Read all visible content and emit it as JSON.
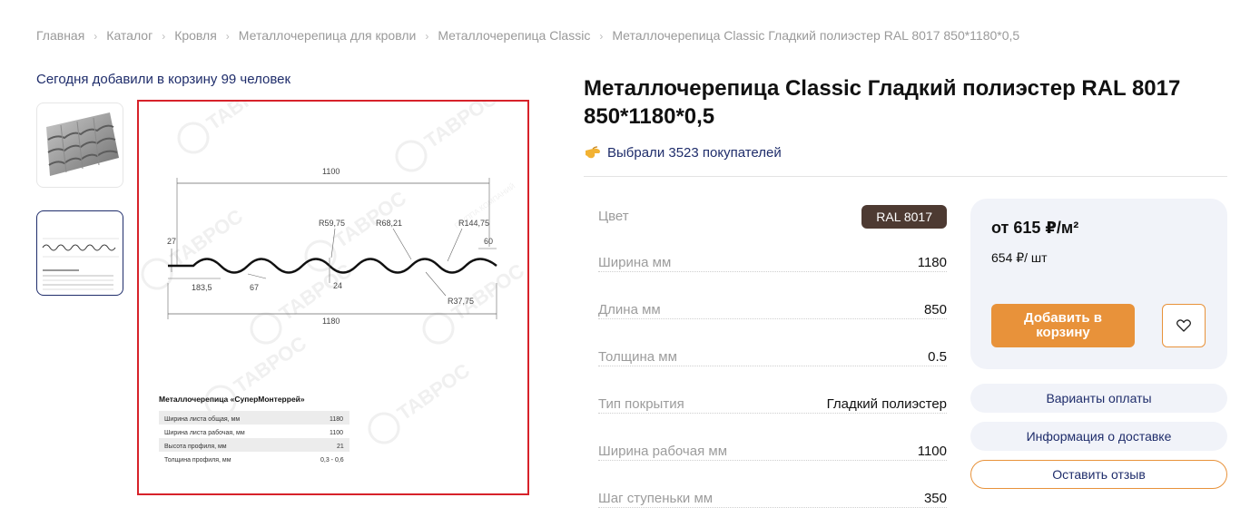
{
  "breadcrumb": {
    "items": [
      "Главная",
      "Каталог",
      "Кровля",
      "Металлочерепица для кровли",
      "Металлочерепица Classic",
      "Металлочерепица Classic Гладкий полиэстер RAL 8017 850*1180*0,5"
    ],
    "separator": "›"
  },
  "added_note": "Сегодня добавили в корзину 99 человек",
  "product": {
    "title": "Металлочерепица Classic Гладкий полиэстер RAL 8017 850*1180*0,5",
    "chosen_text": "Выбрали 3523 покупателей",
    "chosen_icon": "pointing-hand-icon"
  },
  "drawing": {
    "watermark": "ТАВРОС",
    "watermark_sub": "ГРУППА КОМПАНИЙ",
    "dims": {
      "top_width": "1100",
      "bottom_width": "1180",
      "left_height": "27",
      "right_end": "60",
      "r1": "R59,75",
      "r2": "R68,21",
      "r3": "R144,75",
      "r4": "R37,75",
      "pitch": "183,5",
      "wave": "67",
      "depth": "24"
    },
    "table_title": "Металлочерепица «СуперМонтеррей»",
    "table_rows": [
      {
        "label": "Ширина листа общая, мм",
        "value": "1180"
      },
      {
        "label": "Ширина листа рабочая, мм",
        "value": "1100"
      },
      {
        "label": "Высота профиля, мм",
        "value": "21"
      },
      {
        "label": "Толщина профиля, мм",
        "value": "0,3 - 0,6"
      }
    ]
  },
  "specs": [
    {
      "label": "Цвет",
      "value": "RAL 8017",
      "badge": true
    },
    {
      "label": "Ширина мм",
      "value": "1180"
    },
    {
      "label": "Длина мм",
      "value": "850"
    },
    {
      "label": "Толщина мм",
      "value": "0.5"
    },
    {
      "label": "Тип покрытия",
      "value": "Гладкий полиэстер"
    },
    {
      "label": "Ширина рабочая мм",
      "value": "1100"
    },
    {
      "label": "Шаг ступеньки мм",
      "value": "350"
    }
  ],
  "price": {
    "main": "от 615 ₽/м²",
    "sub": "654 ₽/ шт",
    "cart_label": "Добавить в корзину"
  },
  "side_buttons": {
    "payment": "Варианты оплаты",
    "delivery": "Информация о доставке",
    "review": "Оставить отзыв"
  },
  "colors": {
    "accent_orange": "#e8923a",
    "badge_brown": "#4d3a32",
    "link_navy": "#1f2d6b",
    "highlight_red": "#d7222a"
  }
}
